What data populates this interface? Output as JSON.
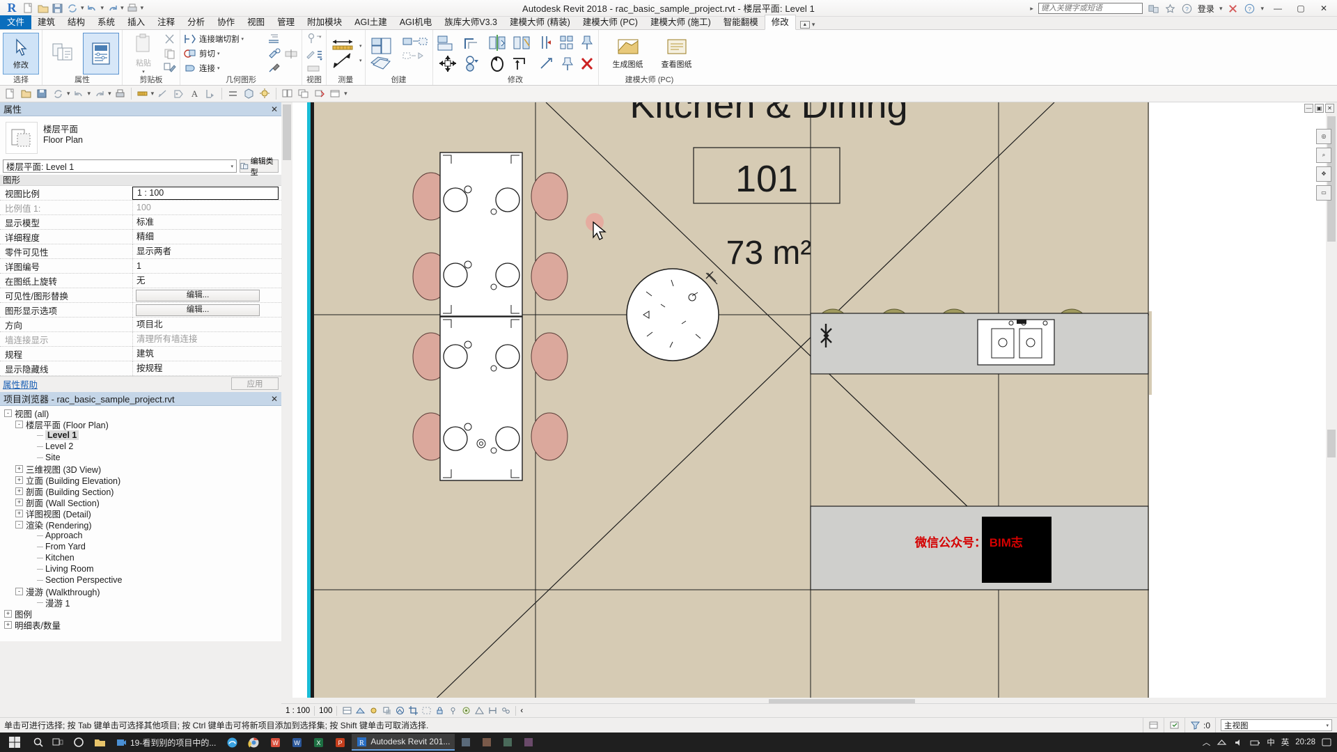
{
  "titlebar": {
    "logo": "R",
    "title": "Autodesk Revit 2018 -    rac_basic_sample_project.rvt - 楼层平面: Level 1",
    "search_placeholder": "键入关键字或短语",
    "signin": "登录",
    "quick_access": [
      "new-icon",
      "open-icon",
      "save-icon",
      "print-icon",
      "undo-icon",
      "redo-icon",
      "sync-icon"
    ],
    "right_icons": [
      "exchange-icon",
      "star-icon",
      "question-icon",
      "help-icon"
    ],
    "window_buttons": [
      "minimize",
      "maximize",
      "close"
    ]
  },
  "ribbon_tabs": {
    "file": "文件",
    "items": [
      "建筑",
      "结构",
      "系统",
      "插入",
      "注释",
      "分析",
      "协作",
      "视图",
      "管理",
      "附加模块",
      "AGI土建",
      "AGI机电",
      "族库大师V3.3",
      "建模大师 (精装)",
      "建模大师 (PC)",
      "建模大师 (施工)",
      "智能翻模",
      "修改"
    ],
    "active": "修改"
  },
  "ribbon_panels": [
    {
      "label": "选择",
      "buttons": [
        {
          "label": "修改",
          "icon": "arrow-cursor-icon",
          "state": "selected"
        }
      ]
    },
    {
      "label": "属性",
      "buttons": [
        {
          "label": "",
          "icon": "type-properties-icon",
          "state": "normal"
        },
        {
          "label": "",
          "icon": "properties-panel-icon",
          "state": "selected"
        }
      ]
    },
    {
      "label": "剪贴板",
      "buttons": [
        {
          "label": "粘贴",
          "icon": "paste-icon",
          "state": "disabled"
        },
        {
          "label": "",
          "icon": "cut-icon",
          "state": "normal"
        },
        {
          "label": "",
          "icon": "copy-icon",
          "state": "normal"
        },
        {
          "label": "",
          "icon": "match-type-icon",
          "state": "normal"
        }
      ]
    },
    {
      "label": "几何图形",
      "rows": [
        {
          "label": "连接端切割",
          "icon": "join-end-cut-icon",
          "dropdown": true
        },
        {
          "label": "剪切",
          "icon": "cut-geometry-icon",
          "dropdown": true
        },
        {
          "label": "连接",
          "icon": "join-geometry-icon",
          "dropdown": true
        }
      ],
      "extra_icons": [
        "split-face-icon",
        "paint-icon",
        "demolish-icon",
        "split-element-icon",
        "wall-joins-icon"
      ]
    },
    {
      "label": "视图",
      "icons": [
        "hide-element-icon",
        "reveal-hidden-icon",
        "paint-brush-icon",
        "linework-icon",
        "cutback-icon"
      ]
    },
    {
      "label": "测量",
      "icons": [
        "measure-between-icon",
        "measure-along-icon"
      ]
    },
    {
      "label": "创建",
      "icons": [
        "create-similar-icon",
        "create-group-icon",
        "create-part-icon",
        "create-assembly-icon"
      ]
    },
    {
      "label": "修改",
      "icons": [
        "align-icon",
        "offset-icon",
        "mirror-axis-icon",
        "mirror-pick-icon",
        "move-icon",
        "copy-icon",
        "rotate-icon",
        "trim-extend-icon",
        "split-icon",
        "array-icon",
        "scale-icon",
        "pin-icon",
        "unpin-icon",
        "delete-icon"
      ]
    },
    {
      "label": "建模大师 (PC)",
      "buttons": [
        {
          "label": "生成图纸",
          "icon": "generate-drawing-icon"
        },
        {
          "label": "查看图纸",
          "icon": "view-drawing-icon"
        }
      ]
    }
  ],
  "options_toolbar": {
    "icons": [
      "new-file-icon",
      "open-icon",
      "save-icon",
      "sync-icon",
      "undo-icon",
      "redo-icon",
      "print-icon",
      "measure-icon",
      "aligned-dim-icon",
      "tag-icon",
      "text-icon",
      "section-icon",
      "thin-line-icon",
      "render-icon",
      "3d-view-icon",
      "pan-icon",
      "zoom-icon",
      "tile-window-icon",
      "cascade-icon",
      "close-hidden-icon",
      "switch-window-icon"
    ]
  },
  "properties": {
    "title": "属性",
    "close_icon": "close-icon",
    "thumbnail_icon": "floor-plan-thumb-icon",
    "family_cn": "楼层平面",
    "family_en": "Floor Plan",
    "type_selector": "楼层平面: Level 1",
    "edit_type_label": "编辑类型",
    "edit_type_icon": "edit-type-icon",
    "group_header": "图形",
    "rows": [
      {
        "key": "视图比例",
        "value": "1 : 100",
        "kind": "active"
      },
      {
        "key": "比例值    1:",
        "value": "100",
        "kind": "disabled"
      },
      {
        "key": "显示模型",
        "value": "标准",
        "kind": "text"
      },
      {
        "key": "详细程度",
        "value": "精细",
        "kind": "text"
      },
      {
        "key": "零件可见性",
        "value": "显示两者",
        "kind": "text"
      },
      {
        "key": "详图编号",
        "value": "1",
        "kind": "text"
      },
      {
        "key": "在图纸上旋转",
        "value": "无",
        "kind": "text"
      },
      {
        "key": "可见性/图形替换",
        "value": "编辑...",
        "kind": "button"
      },
      {
        "key": "图形显示选项",
        "value": "编辑...",
        "kind": "button"
      },
      {
        "key": "方向",
        "value": "项目北",
        "kind": "text"
      },
      {
        "key": "墙连接显示",
        "value": "清理所有墙连接",
        "kind": "disabled"
      },
      {
        "key": "规程",
        "value": "建筑",
        "kind": "text"
      },
      {
        "key": "显示隐藏线",
        "value": "按规程",
        "kind": "text"
      }
    ],
    "help_link": "属性帮助",
    "apply_button": "应用"
  },
  "project_browser": {
    "title": "项目浏览器 - rac_basic_sample_project.rvt",
    "close_icon": "close-icon",
    "tree": [
      {
        "label": "视图 (all)",
        "depth": 0,
        "toggle": "-",
        "icon": "views-icon"
      },
      {
        "label": "楼层平面 (Floor Plan)",
        "depth": 1,
        "toggle": "-"
      },
      {
        "label": "Level 1",
        "depth": 2,
        "toggle": "",
        "selected": true
      },
      {
        "label": "Level 2",
        "depth": 2,
        "toggle": ""
      },
      {
        "label": "Site",
        "depth": 2,
        "toggle": ""
      },
      {
        "label": "三维视图 (3D View)",
        "depth": 1,
        "toggle": "+"
      },
      {
        "label": "立面 (Building Elevation)",
        "depth": 1,
        "toggle": "+"
      },
      {
        "label": "剖面 (Building Section)",
        "depth": 1,
        "toggle": "+"
      },
      {
        "label": "剖面 (Wall Section)",
        "depth": 1,
        "toggle": "+"
      },
      {
        "label": "详图视图 (Detail)",
        "depth": 1,
        "toggle": "+"
      },
      {
        "label": "渲染 (Rendering)",
        "depth": 1,
        "toggle": "-"
      },
      {
        "label": "Approach",
        "depth": 2,
        "toggle": ""
      },
      {
        "label": "From Yard",
        "depth": 2,
        "toggle": ""
      },
      {
        "label": "Kitchen",
        "depth": 2,
        "toggle": ""
      },
      {
        "label": "Living Room",
        "depth": 2,
        "toggle": ""
      },
      {
        "label": "Section Perspective",
        "depth": 2,
        "toggle": ""
      },
      {
        "label": "漫游 (Walkthrough)",
        "depth": 1,
        "toggle": "-"
      },
      {
        "label": "漫游 1",
        "depth": 2,
        "toggle": ""
      },
      {
        "label": "图例",
        "depth": 0,
        "toggle": "+"
      },
      {
        "label": "明细表/数量",
        "depth": 0,
        "toggle": "+"
      }
    ]
  },
  "canvas": {
    "room_name": "Kitchen & Dining",
    "room_number": "101",
    "room_area": "73 m²",
    "watermark": "微信公众号： BIM志",
    "view_controls": [
      "minimize-icon",
      "restore-icon",
      "close-icon"
    ],
    "nav_icons": [
      "steering-wheel-icon",
      "zoom-region-icon",
      "pan-icon",
      "fit-icon"
    ]
  },
  "view_control_bar": {
    "scale": "1 : 100",
    "scale_value": "100",
    "icons": [
      "detail-level-icon",
      "visual-style-icon",
      "sun-path-icon",
      "shadows-icon",
      "rendering-icon",
      "crop-view-icon",
      "show-crop-icon",
      "lock-3d-icon",
      "temp-hide-icon",
      "reveal-hidden-icon",
      "analytical-model-icon",
      "constraints-icon",
      "worksharing-icon"
    ],
    "nav_arrow": "‹"
  },
  "statusbar": {
    "message": "单击可进行选择; 按 Tab 键单击可选择其他项目; 按 Ctrl 键单击可将新项目添加到选择集; 按 Shift 键单击可取消选择.",
    "filter_icon": "filter-icon",
    "count": ":0",
    "selector_value": "主视图",
    "icons": [
      "exclude-options-icon",
      "editable-only-icon"
    ]
  },
  "taskbar": {
    "start_icon": "windows-start-icon",
    "search_icon": "search-icon",
    "pinned": [
      {
        "icon": "task-view-icon",
        "label": ""
      },
      {
        "icon": "cortana-circle-icon",
        "label": ""
      },
      {
        "icon": "folder-icon",
        "label": ""
      },
      {
        "icon": "video-icon",
        "label": "19-看到别的项目中的..."
      },
      {
        "icon": "edge-icon",
        "label": ""
      },
      {
        "icon": "chrome-icon",
        "label": ""
      },
      {
        "icon": "wps-icon",
        "label": ""
      },
      {
        "icon": "word-icon",
        "label": ""
      },
      {
        "icon": "excel-icon",
        "label": ""
      },
      {
        "icon": "ppt-icon",
        "label": ""
      }
    ],
    "active_task": {
      "icon": "revit-icon",
      "label": "Autodesk Revit 201..."
    },
    "tray_icons": [
      "up-chevron-icon",
      "network-icon",
      "speaker-icon",
      "battery-icon",
      "ime-cn-icon",
      "ime-abc-icon",
      "notification-icon"
    ],
    "ime": [
      "中",
      "英"
    ],
    "clock": "20:28"
  }
}
